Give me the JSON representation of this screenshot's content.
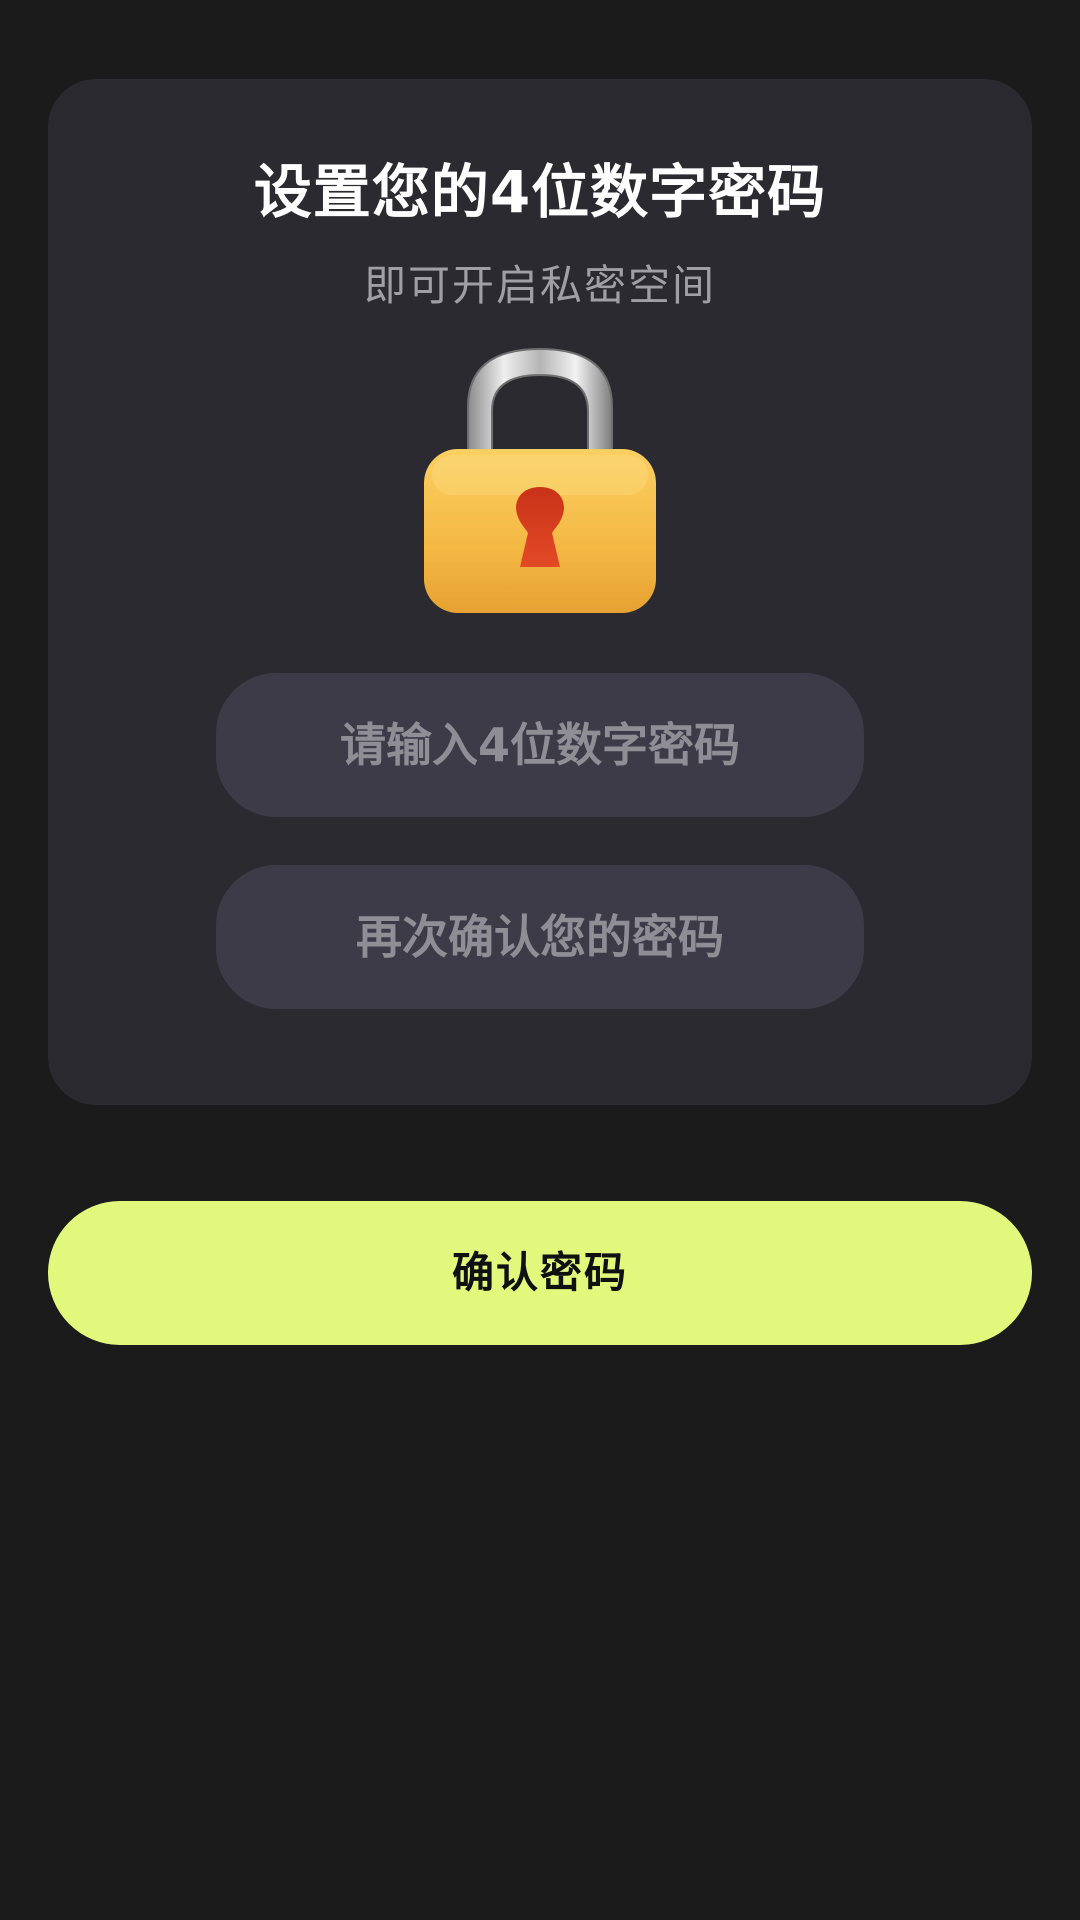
{
  "header": {
    "title": "设置您的4位数字密码",
    "subtitle": "即可开启私密空间"
  },
  "lock_icon": {
    "name": "padlock-icon",
    "body_color": "#f6bd4a",
    "keyhole_color": "#d84423",
    "shackle_color": "#c9c9c9"
  },
  "form": {
    "password_placeholder": "请输入4位数字密码",
    "confirm_placeholder": "再次确认您的密码"
  },
  "actions": {
    "confirm_label": "确认密码"
  },
  "colors": {
    "background": "#1b1b1c",
    "card": "#2b2a30",
    "field": "#3d3b48",
    "accent": "#e1f87c"
  }
}
